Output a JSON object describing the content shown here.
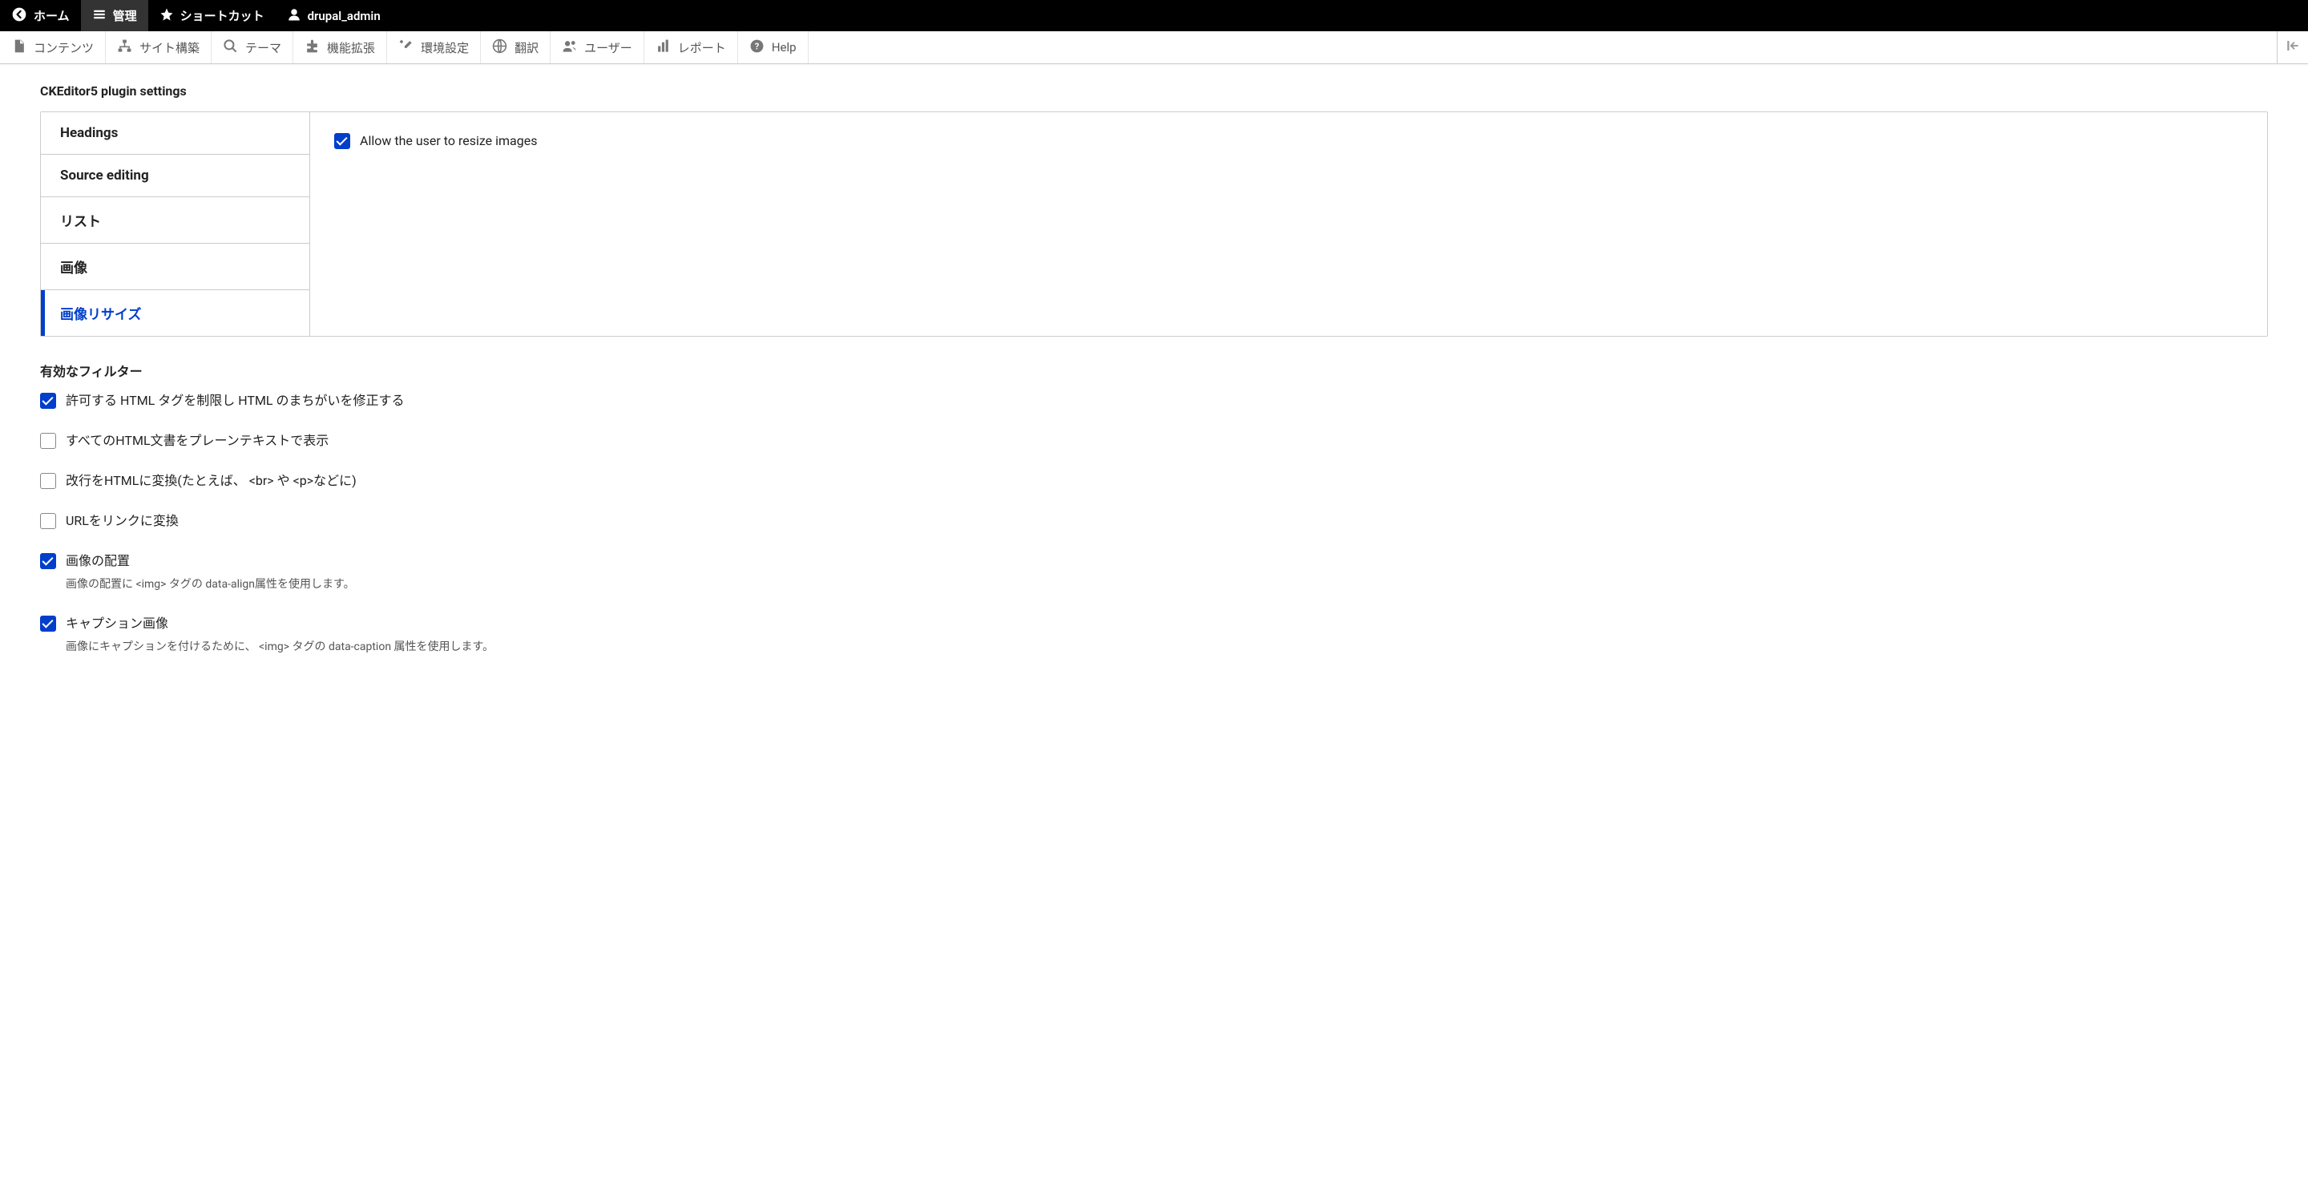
{
  "topbar": {
    "home": "ホーム",
    "manage": "管理",
    "shortcuts": "ショートカット",
    "user": "drupal_admin"
  },
  "admintoolbar": {
    "content": "コンテンツ",
    "structure": "サイト構築",
    "appearance": "テーマ",
    "extend": "機能拡張",
    "config": "環境設定",
    "translate": "翻訳",
    "people": "ユーザー",
    "reports": "レポート",
    "help": "Help"
  },
  "plugin": {
    "title": "CKEditor5 plugin settings",
    "tabs": {
      "headings": "Headings",
      "source": "Source editing",
      "list": "リスト",
      "image": "画像",
      "resize": "画像リサイズ"
    },
    "resize_allow": "Allow the user to resize images"
  },
  "filters": {
    "title": "有効なフィルター",
    "items": [
      {
        "label": "許可する HTML タグを制限し HTML のまちがいを修正する",
        "checked": true,
        "desc": ""
      },
      {
        "label": "すべてのHTML文書をプレーンテキストで表示",
        "checked": false,
        "desc": ""
      },
      {
        "label": "改行をHTMLに変換(たとえば、 <br> や <p>などに)",
        "checked": false,
        "desc": ""
      },
      {
        "label": "URLをリンクに変換",
        "checked": false,
        "desc": ""
      },
      {
        "label": "画像の配置",
        "checked": true,
        "desc": "画像の配置に <img> タグの data-align属性を使用します。"
      },
      {
        "label": "キャプション画像",
        "checked": true,
        "desc": "画像にキャプションを付けるために、 <img> タグの data-caption 属性を使用します。"
      }
    ]
  }
}
